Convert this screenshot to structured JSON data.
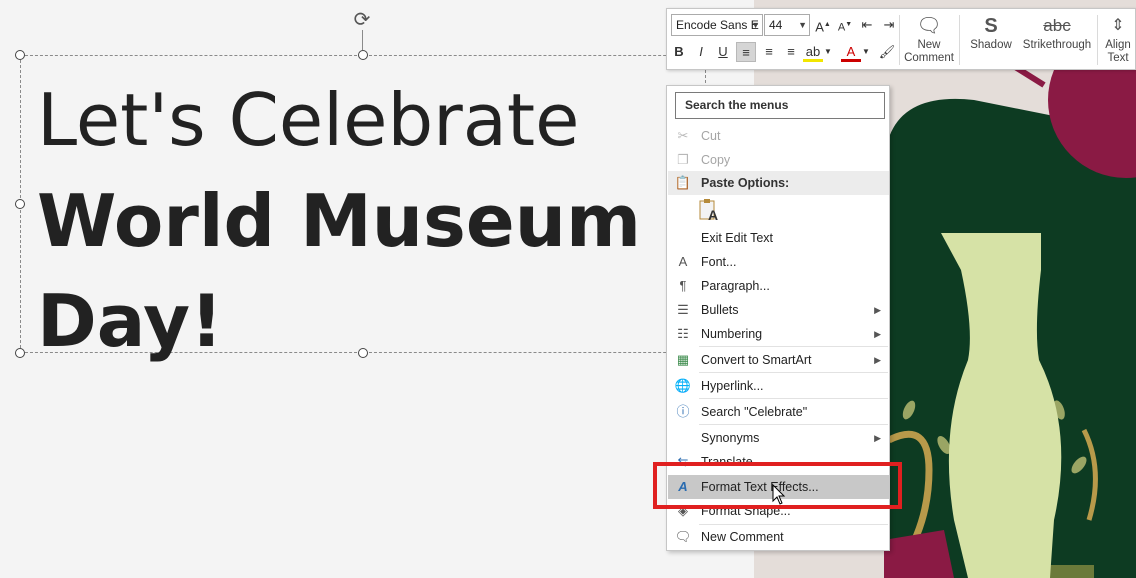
{
  "slide": {
    "line1": "Let's Celebrate",
    "line2": "World Museum",
    "line3": "Day!"
  },
  "toolbar": {
    "font_name": "Encode Sans E",
    "font_size": "44",
    "new_comment_label_1": "New",
    "new_comment_label_2": "Comment",
    "shadow_label": "Shadow",
    "strikethrough_label": "Strikethrough",
    "align_text_label_1": "Align",
    "align_text_label_2": "Text",
    "bold_glyph": "B",
    "italic_glyph": "I",
    "underline_glyph": "U"
  },
  "menu": {
    "search_placeholder": "Search the menus",
    "items": [
      {
        "label": "Cut",
        "icon": "scissors-icon",
        "disabled": true
      },
      {
        "label": "Copy",
        "icon": "copy-icon",
        "disabled": true
      },
      {
        "label": "Paste Options:",
        "icon": "paste-icon",
        "header": true
      },
      {
        "label": "Exit Edit Text"
      },
      {
        "label": "Font...",
        "icon": "font-icon"
      },
      {
        "label": "Paragraph...",
        "icon": "paragraph-icon"
      },
      {
        "label": "Bullets",
        "icon": "bullets-icon",
        "submenu": true
      },
      {
        "label": "Numbering",
        "icon": "numbering-icon",
        "submenu": true
      },
      {
        "label": "Convert to SmartArt",
        "icon": "smartart-icon",
        "submenu": true
      },
      {
        "label": "Hyperlink...",
        "icon": "hyperlink-icon"
      },
      {
        "label": "Search \"Celebrate\"",
        "icon": "smart-lookup-icon"
      },
      {
        "label": "Synonyms",
        "submenu": true
      },
      {
        "label": "Translate",
        "icon": "translate-icon"
      },
      {
        "label": "Format Text Effects...",
        "icon": "text-effects-icon",
        "hover": true
      },
      {
        "label": "Format Shape...",
        "icon": "format-shape-icon"
      },
      {
        "label": "New Comment",
        "icon": "new-comment-icon"
      }
    ]
  },
  "colors": {
    "highlight": "#e02020",
    "art_dark_green": "#0d3b22",
    "art_maroon": "#8a1a44",
    "art_vase": "#d6e2a6",
    "art_gold": "#b89a4a"
  }
}
